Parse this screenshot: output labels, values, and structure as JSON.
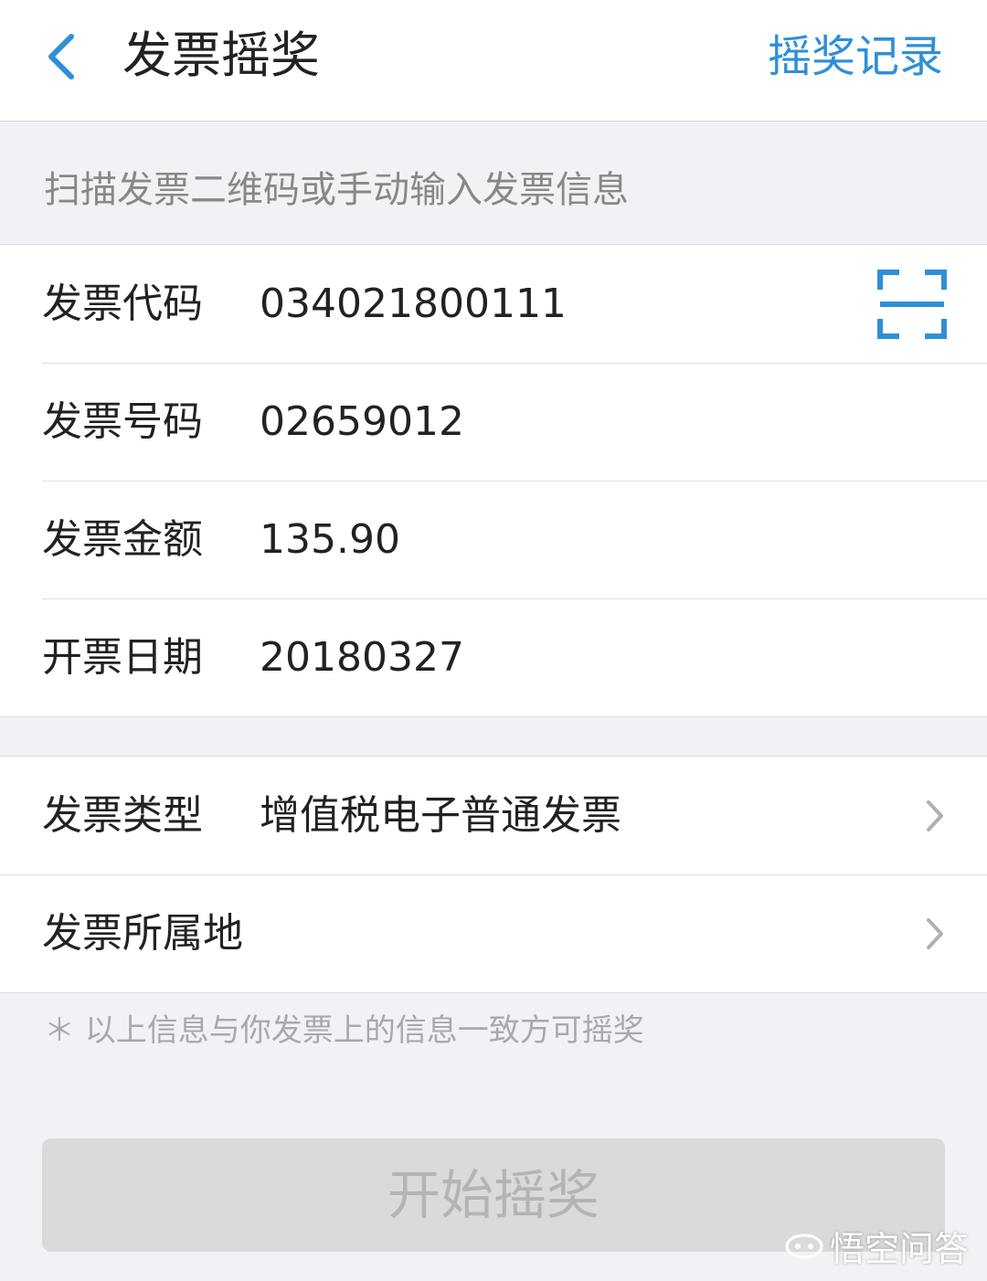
{
  "header": {
    "title": "发票摇奖",
    "records_link": "摇奖记录"
  },
  "hint": "扫描发票二维码或手动输入发票信息",
  "invoice_fields": [
    {
      "label": "发票代码",
      "value": "034021800111"
    },
    {
      "label": "发票号码",
      "value": "02659012"
    },
    {
      "label": "发票金额",
      "value": "135.90"
    },
    {
      "label": "开票日期",
      "value": "20180327"
    }
  ],
  "select_fields": [
    {
      "label": "发票类型",
      "value": "增值税电子普通发票"
    },
    {
      "label": "发票所属地",
      "value": ""
    }
  ],
  "note": "＊ 以上信息与你发票上的信息一致方可摇奖",
  "start_button": "开始摇奖",
  "watermark": "悟空问答",
  "colors": {
    "accent": "#2e8fd8",
    "background": "#f2f2f6",
    "button_disabled": "#dadadc"
  },
  "icons": {
    "back": "chevron-left-icon",
    "scan": "scan-frame-icon",
    "arrow": "chevron-right-icon"
  }
}
